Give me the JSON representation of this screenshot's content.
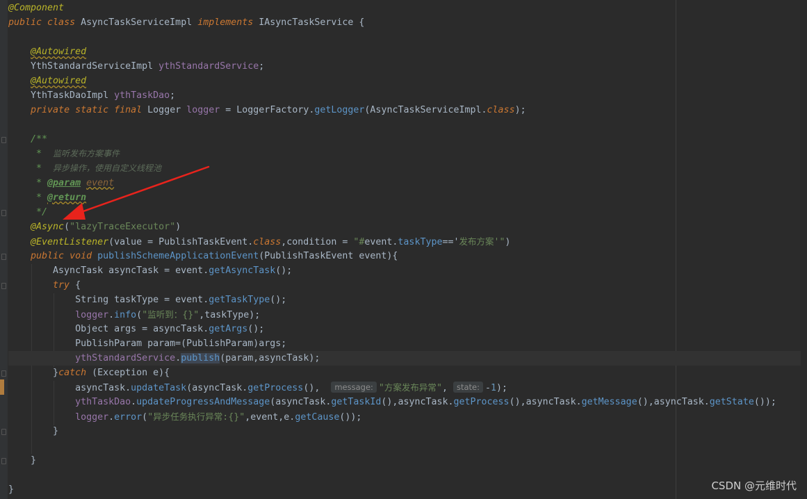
{
  "code_lines": [
    {
      "tokens": [
        {
          "t": "@Component",
          "k": "ann"
        }
      ]
    },
    {
      "tokens": [
        {
          "t": "public ",
          "k": "kw"
        },
        {
          "t": "class ",
          "k": "kw"
        },
        {
          "t": "AsyncTaskServiceImpl ",
          "k": "default"
        },
        {
          "t": "implements ",
          "k": "kw"
        },
        {
          "t": "IAsyncTaskService {",
          "k": "default"
        }
      ]
    },
    {
      "tokens": []
    },
    {
      "tokens": [
        {
          "t": "    ",
          "k": "default"
        },
        {
          "t": "@Autowired",
          "k": "annu"
        }
      ]
    },
    {
      "tokens": [
        {
          "t": "    YthStandardServiceImpl ",
          "k": "default"
        },
        {
          "t": "ythStandardService",
          "k": "field"
        },
        {
          "t": ";",
          "k": "default"
        }
      ]
    },
    {
      "tokens": [
        {
          "t": "    ",
          "k": "default"
        },
        {
          "t": "@Autowired",
          "k": "annu"
        }
      ]
    },
    {
      "tokens": [
        {
          "t": "    YthTaskDaoImpl ",
          "k": "default"
        },
        {
          "t": "ythTaskDao",
          "k": "field"
        },
        {
          "t": ";",
          "k": "default"
        }
      ]
    },
    {
      "tokens": [
        {
          "t": "    ",
          "k": "default"
        },
        {
          "t": "private ",
          "k": "kw"
        },
        {
          "t": "static ",
          "k": "kw"
        },
        {
          "t": "final ",
          "k": "kw"
        },
        {
          "t": "Logger ",
          "k": "default"
        },
        {
          "t": "logger",
          "k": "field"
        },
        {
          "t": " = LoggerFactory.",
          "k": "default"
        },
        {
          "t": "getLogger",
          "k": "method"
        },
        {
          "t": "(AsyncTaskServiceImpl.",
          "k": "default"
        },
        {
          "t": "class",
          "k": "kw"
        },
        {
          "t": ");",
          "k": "default"
        }
      ]
    },
    {
      "tokens": []
    },
    {
      "tokens": [
        {
          "t": "    /**",
          "k": "comment"
        }
      ]
    },
    {
      "tokens": [
        {
          "t": "     *  ",
          "k": "comment"
        },
        {
          "t": "监听发布方案事件",
          "k": "comment-cn"
        }
      ]
    },
    {
      "tokens": [
        {
          "t": "     *  ",
          "k": "comment"
        },
        {
          "t": "异步操作，使用自定义线程池",
          "k": "comment-cn"
        }
      ]
    },
    {
      "tokens": [
        {
          "t": "     * ",
          "k": "comment"
        },
        {
          "t": "@param",
          "k": "doctag"
        },
        {
          "t": " ",
          "k": "comment"
        },
        {
          "t": "event",
          "k": "docparam"
        }
      ]
    },
    {
      "tokens": [
        {
          "t": "     * ",
          "k": "comment"
        },
        {
          "t": "@return",
          "k": "doctagu"
        }
      ]
    },
    {
      "tokens": [
        {
          "t": "     */",
          "k": "comment"
        }
      ]
    },
    {
      "tokens": [
        {
          "t": "    ",
          "k": "default"
        },
        {
          "t": "@Async",
          "k": "ann"
        },
        {
          "t": "(",
          "k": "default"
        },
        {
          "t": "\"lazyTraceExecutor\"",
          "k": "string"
        },
        {
          "t": ")",
          "k": "default"
        }
      ]
    },
    {
      "tokens": [
        {
          "t": "    ",
          "k": "default"
        },
        {
          "t": "@EventListener",
          "k": "ann"
        },
        {
          "t": "(value = PublishTaskEvent.",
          "k": "default"
        },
        {
          "t": "class",
          "k": "kw"
        },
        {
          "t": ",condition = ",
          "k": "default"
        },
        {
          "t": "\"#",
          "k": "string"
        },
        {
          "t": "event.",
          "k": "default"
        },
        {
          "t": "taskType",
          "k": "method"
        },
        {
          "t": "=='",
          "k": "default"
        },
        {
          "t": "发布方案",
          "k": "cnstr"
        },
        {
          "t": "'\"",
          "k": "string"
        },
        {
          "t": ")",
          "k": "default"
        }
      ]
    },
    {
      "tokens": [
        {
          "t": "    ",
          "k": "default"
        },
        {
          "t": "public ",
          "k": "kw"
        },
        {
          "t": "void ",
          "k": "kw"
        },
        {
          "t": "publishSchemeApplicationEvent",
          "k": "method"
        },
        {
          "t": "(PublishTaskEvent event){",
          "k": "default"
        }
      ]
    },
    {
      "tokens": [
        {
          "t": "        AsyncTask asyncTask = event.",
          "k": "default"
        },
        {
          "t": "getAsyncTask",
          "k": "method"
        },
        {
          "t": "();",
          "k": "default"
        }
      ]
    },
    {
      "tokens": [
        {
          "t": "        ",
          "k": "default"
        },
        {
          "t": "try ",
          "k": "kw"
        },
        {
          "t": "{",
          "k": "default"
        }
      ]
    },
    {
      "tokens": [
        {
          "t": "            String taskType = event.",
          "k": "default"
        },
        {
          "t": "getTaskType",
          "k": "method"
        },
        {
          "t": "();",
          "k": "default"
        }
      ]
    },
    {
      "tokens": [
        {
          "t": "            ",
          "k": "default"
        },
        {
          "t": "logger",
          "k": "field"
        },
        {
          "t": ".",
          "k": "default"
        },
        {
          "t": "info",
          "k": "method"
        },
        {
          "t": "(",
          "k": "default"
        },
        {
          "t": "\"",
          "k": "string"
        },
        {
          "t": "监听到：",
          "k": "cnstr"
        },
        {
          "t": "{}\"",
          "k": "string"
        },
        {
          "t": ",taskType);",
          "k": "default"
        }
      ]
    },
    {
      "tokens": [
        {
          "t": "            Object args = asyncTask.",
          "k": "default"
        },
        {
          "t": "getArgs",
          "k": "method"
        },
        {
          "t": "();",
          "k": "default"
        }
      ]
    },
    {
      "tokens": [
        {
          "t": "            PublishParam param=(PublishParam)args;",
          "k": "default"
        }
      ]
    },
    {
      "hl": true,
      "tokens": [
        {
          "t": "            ",
          "k": "default"
        },
        {
          "t": "ythStandardService",
          "k": "field"
        },
        {
          "t": ".",
          "k": "default"
        },
        {
          "t": "publish",
          "k": "method-hl"
        },
        {
          "t": "(param,asyncTask);",
          "k": "default"
        }
      ]
    },
    {
      "tokens": [
        {
          "t": "        }",
          "k": "default"
        },
        {
          "t": "catch ",
          "k": "kw"
        },
        {
          "t": "(Exception e){",
          "k": "default"
        }
      ]
    },
    {
      "tokens": [
        {
          "t": "            asyncTask.",
          "k": "default"
        },
        {
          "t": "updateTask",
          "k": "method"
        },
        {
          "t": "(asyncTask.",
          "k": "default"
        },
        {
          "t": "getProcess",
          "k": "method"
        },
        {
          "t": "(),  ",
          "k": "default"
        },
        {
          "t": "message:",
          "k": "hint"
        },
        {
          "t": "\"",
          "k": "string"
        },
        {
          "t": "方案发布异常",
          "k": "cnstr"
        },
        {
          "t": "\"",
          "k": "string"
        },
        {
          "t": ", ",
          "k": "default"
        },
        {
          "t": "state:",
          "k": "hint"
        },
        {
          "t": "-",
          "k": "default"
        },
        {
          "t": "1",
          "k": "number"
        },
        {
          "t": ");",
          "k": "default"
        }
      ]
    },
    {
      "tokens": [
        {
          "t": "            ",
          "k": "default"
        },
        {
          "t": "ythTaskDao",
          "k": "field"
        },
        {
          "t": ".",
          "k": "default"
        },
        {
          "t": "updateProgressAndMessage",
          "k": "method"
        },
        {
          "t": "(asyncTask.",
          "k": "default"
        },
        {
          "t": "getTaskId",
          "k": "method"
        },
        {
          "t": "(),asyncTask.",
          "k": "default"
        },
        {
          "t": "getProcess",
          "k": "method"
        },
        {
          "t": "(),asyncTask.",
          "k": "default"
        },
        {
          "t": "getMessage",
          "k": "method"
        },
        {
          "t": "(),asyncTask.",
          "k": "default"
        },
        {
          "t": "getState",
          "k": "method"
        },
        {
          "t": "());",
          "k": "default"
        }
      ]
    },
    {
      "tokens": [
        {
          "t": "            ",
          "k": "default"
        },
        {
          "t": "logger",
          "k": "field"
        },
        {
          "t": ".",
          "k": "default"
        },
        {
          "t": "error",
          "k": "method"
        },
        {
          "t": "(",
          "k": "default"
        },
        {
          "t": "\"",
          "k": "string"
        },
        {
          "t": "异步任务执行异常",
          "k": "cnstr"
        },
        {
          "t": ":{}\"",
          "k": "string"
        },
        {
          "t": ",event,e.",
          "k": "default"
        },
        {
          "t": "getCause",
          "k": "method"
        },
        {
          "t": "());",
          "k": "default"
        }
      ]
    },
    {
      "tokens": [
        {
          "t": "        }",
          "k": "default"
        }
      ]
    },
    {
      "tokens": []
    },
    {
      "tokens": [
        {
          "t": "    }",
          "k": "default"
        }
      ]
    },
    {
      "tokens": []
    },
    {
      "tokens": [
        {
          "t": "}",
          "k": "default"
        }
      ]
    }
  ],
  "watermark": "CSDN @元维时代",
  "colors": {
    "background": "#2b2b2b",
    "gutter": "#313335",
    "keyword": "#cc7832",
    "annotation": "#bbb529",
    "field": "#9876aa",
    "method": "#5d95c8",
    "string": "#6a8759",
    "comment": "#629755",
    "arrow": "#e8231c"
  },
  "annotation_arrow": {
    "color": "#e8231c",
    "points_to": "@Async"
  }
}
